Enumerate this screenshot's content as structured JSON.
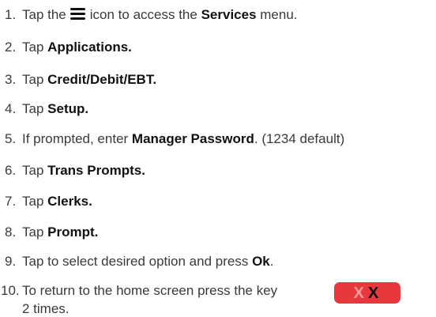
{
  "steps": [
    {
      "num": "1.",
      "pre": "Tap the",
      "icon": "menu-icon",
      "mid": "icon to access the",
      "bold": "Services",
      "post": "menu."
    },
    {
      "num": "2.",
      "pre": "Tap",
      "bold": "Applications."
    },
    {
      "num": "3.",
      "pre": "Tap",
      "bold": "Credit/Debit/EBT."
    },
    {
      "num": "4.",
      "pre": "Tap",
      "bold": "Setup."
    },
    {
      "num": "5.",
      "pre": "If prompted, enter",
      "bold": "Manager Password",
      "post": ". (1234 default)"
    },
    {
      "num": "6.",
      "pre": "Tap",
      "bold": "Trans Prompts."
    },
    {
      "num": "7.",
      "pre": "Tap",
      "bold": "Clerks."
    },
    {
      "num": "8.",
      "pre": "Tap",
      "bold": "Prompt."
    },
    {
      "num": "9.",
      "pre": "Tap to select desired option and press",
      "bold": "Ok",
      "post": "."
    },
    {
      "num": "10.",
      "pre": "To return to the home screen press the key",
      "post": "2 times."
    }
  ],
  "key": {
    "glyph_light": "X",
    "glyph_dark": "X",
    "color": "#e8383d"
  },
  "colors": {
    "text": "#3a3a3a",
    "bold": "#111111"
  }
}
